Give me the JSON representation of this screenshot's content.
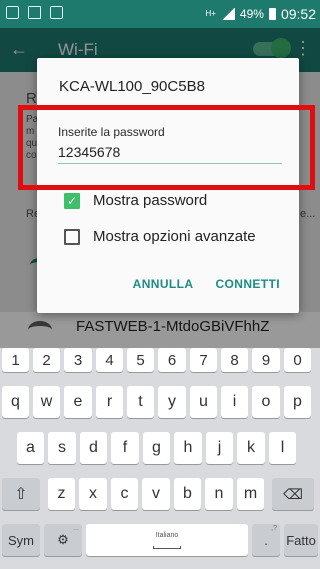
{
  "status_bar": {
    "network": "H+",
    "battery": "49%",
    "time": "09:52"
  },
  "app_bar": {
    "title": "Wi-Fi"
  },
  "background_fragments": {
    "r1": "R",
    "p1": "Pa",
    "p2": "m",
    "p3": "qu",
    "p4": "co",
    "re": "Re",
    "e_end": "e..."
  },
  "dialog": {
    "title": "KCA-WL100_90C5B8",
    "password_label": "Inserite la password",
    "password_value": "12345678",
    "show_password_label": "Mostra password",
    "show_password_checked": true,
    "advanced_options_label": "Mostra opzioni avanzate",
    "advanced_options_checked": false,
    "cancel_label": "ANNULLA",
    "connect_label": "CONNETTI"
  },
  "network_below": {
    "name": "FASTWEB-1-MtdoGBiVFhhZ"
  },
  "keyboard": {
    "numbers": [
      "1",
      "2",
      "3",
      "4",
      "5",
      "6",
      "7",
      "8",
      "9",
      "0"
    ],
    "row1": [
      "q",
      "w",
      "e",
      "r",
      "t",
      "y",
      "u",
      "i",
      "o",
      "p"
    ],
    "row2": [
      "a",
      "s",
      "d",
      "f",
      "g",
      "h",
      "j",
      "k",
      "l"
    ],
    "row3": [
      "z",
      "x",
      "c",
      "v",
      "b",
      "n",
      "m"
    ],
    "sym_label": "Sym",
    "space_label": "Italiano",
    "period_label": ".",
    "period_hint": ",?",
    "done_label": "Fatto",
    "settings_hint": "...",
    "icons": {
      "shift": "shift-icon",
      "backspace": "backspace-icon",
      "settings": "gear-icon"
    }
  },
  "colors": {
    "teal": "#1e7f72",
    "accent": "#1c8c84",
    "check": "#3fbf6a",
    "annotation": "#e00e0e"
  }
}
